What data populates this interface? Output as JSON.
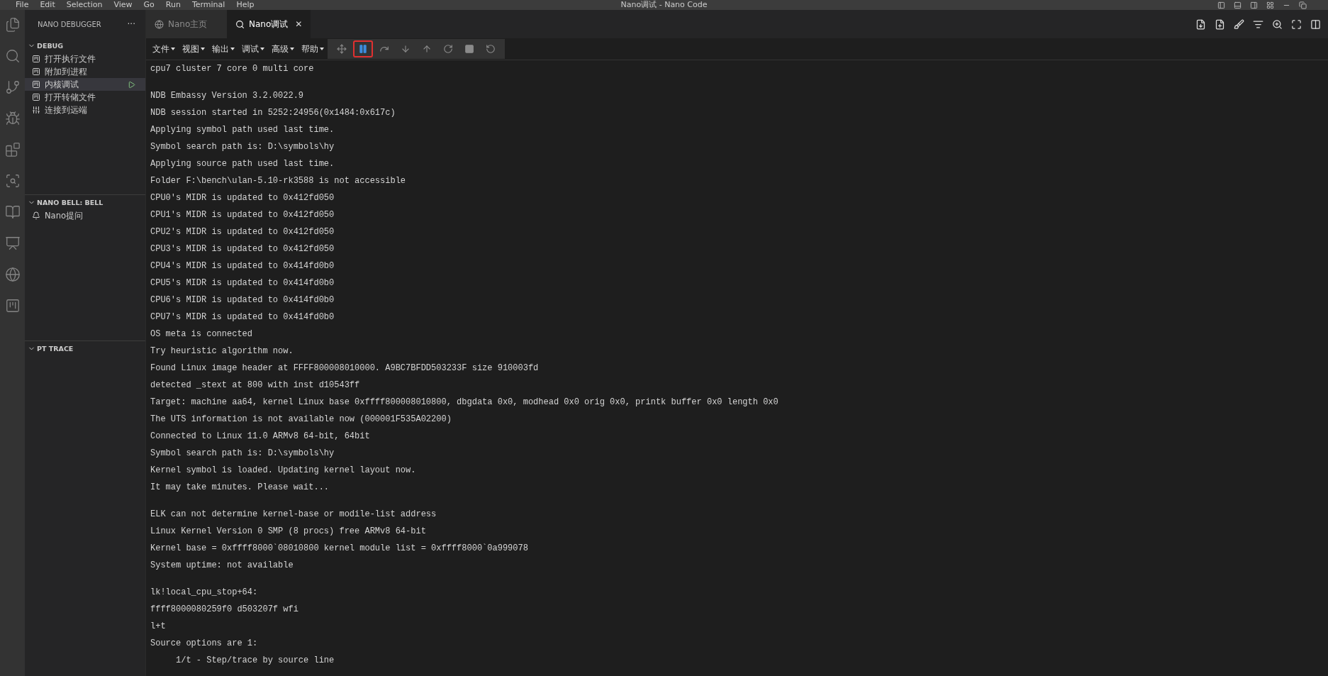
{
  "title_bar": {
    "menu": [
      "File",
      "Edit",
      "Selection",
      "View",
      "Go",
      "Run",
      "Terminal",
      "Help"
    ],
    "title": "Nano调试 - Nano Code"
  },
  "sidebar": {
    "title": "NANO DEBUGGER",
    "more": "···",
    "sections": [
      {
        "title": "DEBUG",
        "expanded": true,
        "items": [
          {
            "label": "打开执行文件",
            "kind": "file",
            "selected": false
          },
          {
            "label": "附加到进程",
            "kind": "file",
            "selected": false
          },
          {
            "label": "内核调试",
            "kind": "file",
            "selected": true
          },
          {
            "label": "打开转储文件",
            "kind": "file",
            "selected": false
          },
          {
            "label": "连接到远端",
            "kind": "connection",
            "selected": false
          }
        ]
      },
      {
        "title": "NANO BELL: BELL",
        "expanded": true,
        "items": [
          {
            "label": "Nano提问",
            "kind": "bell",
            "selected": false
          }
        ]
      },
      {
        "title": "PT TRACE",
        "expanded": true
      }
    ]
  },
  "tabs": [
    {
      "label": "Nano主页",
      "kind": "home",
      "selected": false,
      "closable": false
    },
    {
      "label": "Nano调试",
      "kind": "debug",
      "selected": true,
      "closable": true
    }
  ],
  "tab_close": "✕",
  "toolbar": {
    "menus": [
      "文件",
      "视图",
      "输出",
      "调试",
      "高级",
      "帮助"
    ],
    "debug_controls": [
      {
        "kind": "move",
        "highlighted": false
      },
      {
        "kind": "pause",
        "highlighted": true
      },
      {
        "kind": "step_over",
        "highlighted": false
      },
      {
        "kind": "step_into",
        "highlighted": false
      },
      {
        "kind": "step_out",
        "highlighted": false
      },
      {
        "kind": "restart",
        "highlighted": false
      },
      {
        "kind": "stop",
        "highlighted": false
      },
      {
        "kind": "disconnect",
        "highlighted": false
      }
    ]
  },
  "console": {
    "blocks": [
      [
        "cpu7 cluster 7 core 0 multi core"
      ],
      [
        "NDB Embassy Version 3.2.0022.9",
        "NDB session started in 5252:24956(0x1484:0x617c)",
        "Applying symbol path used last time.",
        "Symbol search path is: D:\\symbols\\hy",
        "Applying source path used last time.",
        "Folder F:\\bench\\ulan-5.10-rk3588 is not accessible",
        "CPU0's MIDR is updated to 0x412fd050",
        "CPU1's MIDR is updated to 0x412fd050",
        "CPU2's MIDR is updated to 0x412fd050",
        "CPU3's MIDR is updated to 0x412fd050",
        "CPU4's MIDR is updated to 0x414fd0b0",
        "CPU5's MIDR is updated to 0x414fd0b0",
        "CPU6's MIDR is updated to 0x414fd0b0",
        "CPU7's MIDR is updated to 0x414fd0b0",
        "OS meta is connected",
        "Try heuristic algorithm now.",
        "Found Linux image header at FFFF800008010000. A9BC7BFDD503233F size 910003fd",
        "detected _stext at 800 with inst d10543ff",
        "Target: machine aa64, kernel Linux base 0xffff800008010800, dbgdata 0x0, modhead 0x0 orig 0x0, printk buffer 0x0 length 0x0",
        "The UTS information is not available now (000001F535A02200)",
        "Connected to Linux 11.0 ARMv8 64-bit, 64bit",
        "Symbol search path is: D:\\symbols\\hy",
        "Kernel symbol is loaded. Updating kernel layout now.",
        "It may take minutes. Please wait..."
      ],
      [
        "ELK can not determine kernel-base or modile-list address",
        "Linux Kernel Version 0 SMP (8 procs) free ARMv8 64-bit",
        "Kernel base = 0xffff8000`08010800 kernel module list = 0xffff8000`0a999078",
        "System uptime: not available"
      ],
      [
        "lk!local_cpu_stop+64:",
        "ffff8000080259f0 d503207f wfi",
        "l+t",
        "Source options are 1:",
        "     1/t - Step/trace by source line"
      ]
    ]
  }
}
